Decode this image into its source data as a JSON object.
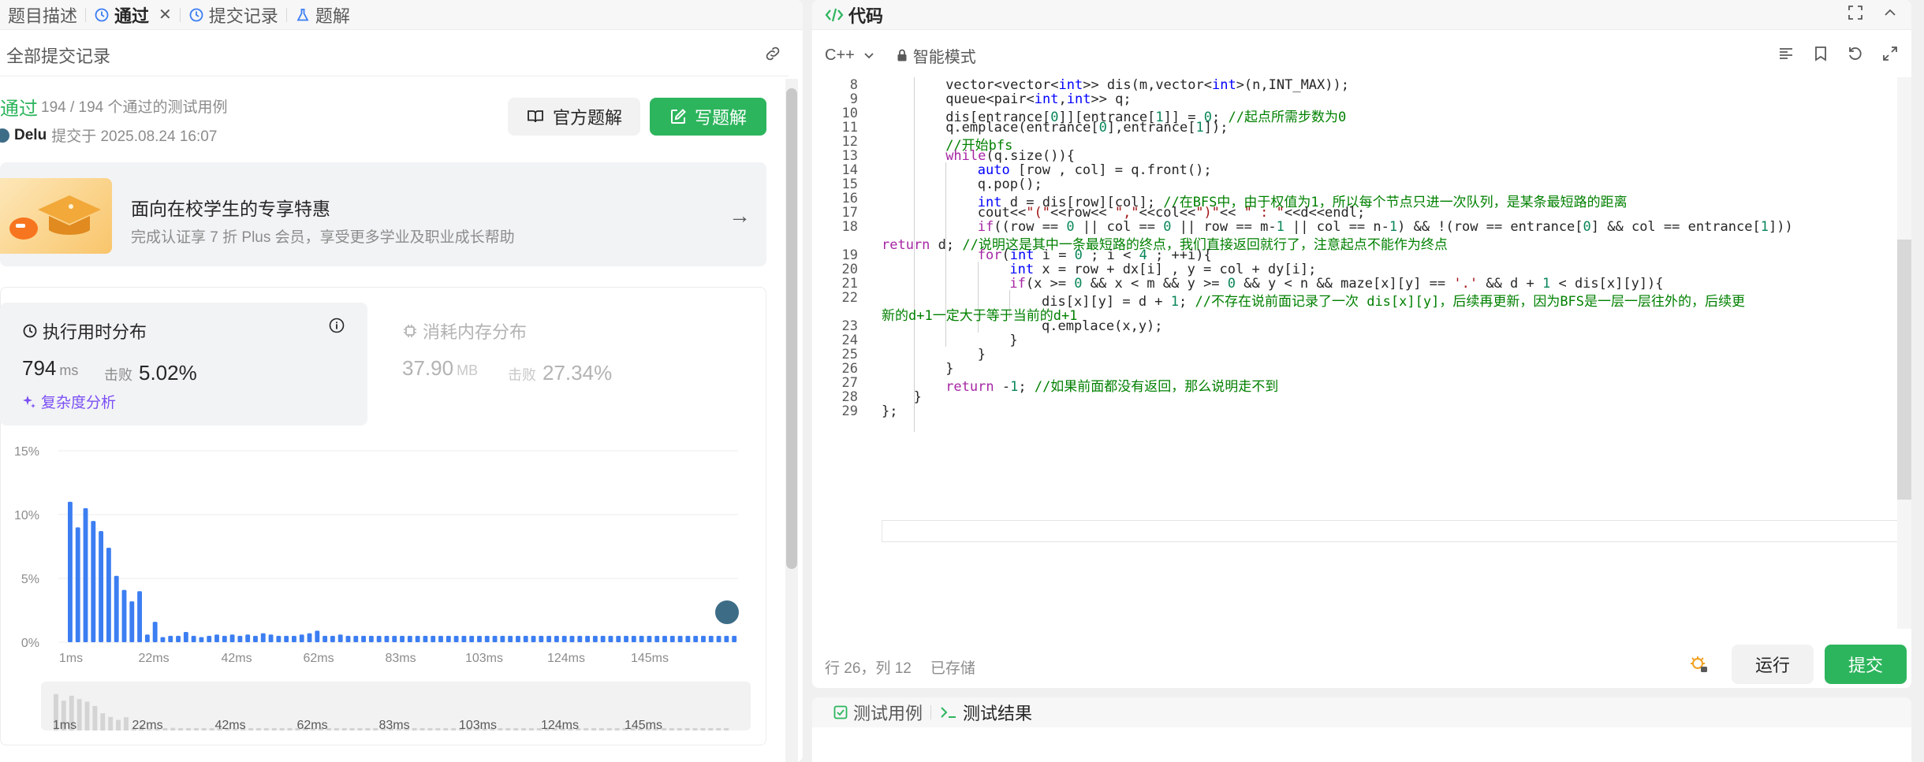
{
  "left_tabs": [
    {
      "label": "题目描述",
      "active": false
    },
    {
      "label": "通过",
      "active": true
    },
    {
      "label": "提交记录",
      "active": false
    },
    {
      "label": "题解",
      "active": false
    }
  ],
  "all_submissions_label": "全部提交记录",
  "result": {
    "status": "通过",
    "tests": "194 / 194 个通过的测试用例",
    "user": "Delu",
    "submitted_at": "提交于 2025.08.24 16:07"
  },
  "buttons": {
    "official": "官方题解",
    "write": "写题解",
    "run": "运行",
    "submit": "提交"
  },
  "promo": {
    "title": "面向在校学生的专享特惠",
    "subtitle": "完成认证享 7 折 Plus 会员，享受更多学业及职业成长帮助"
  },
  "runtime": {
    "title": "执行用时分布",
    "value": "794",
    "unit": "ms",
    "beat_label": "击败",
    "beat": "5.02%",
    "complexity": "复杂度分析"
  },
  "memory": {
    "title": "消耗内存分布",
    "value": "37.90",
    "unit": "MB",
    "beat_label": "击败",
    "beat": "27.34%"
  },
  "chart_data": {
    "type": "bar",
    "y_ticks": [
      "15%",
      "10%",
      "5%",
      "0%"
    ],
    "ylim": [
      0,
      15
    ],
    "x_ticks": [
      "1ms",
      "22ms",
      "42ms",
      "62ms",
      "83ms",
      "103ms",
      "124ms",
      "145ms"
    ],
    "overview_ticks": [
      "1ms",
      "22ms",
      "42ms",
      "62ms",
      "83ms",
      "103ms",
      "124ms",
      "145ms"
    ],
    "values": [
      11,
      9,
      10.5,
      9.5,
      8.7,
      7.4,
      5.2,
      4.1,
      3.2,
      4.0,
      0.6,
      1.6,
      0.4,
      0.5,
      0.5,
      0.8,
      0.5,
      0.4,
      0.5,
      0.6,
      0.5,
      0.6,
      0.5,
      0.6,
      0.5,
      0.7,
      0.6,
      0.5,
      0.5,
      0.5,
      0.6,
      0.7,
      0.9,
      0.5,
      0.5,
      0.6,
      0.5,
      0.5,
      0.5,
      0.5,
      0.5,
      0.5,
      0.5,
      0.5,
      0.5,
      0.5,
      0.5,
      0.5,
      0.5,
      0.5,
      0.5,
      0.5,
      0.5,
      0.5,
      0.5,
      0.5,
      0.5,
      0.5,
      0.5,
      0.5,
      0.5,
      0.5,
      0.5,
      0.5,
      0.5,
      0.5,
      0.5,
      0.5,
      0.5,
      0.5,
      0.5,
      0.5,
      0.5,
      0.5,
      0.5,
      0.5,
      0.5,
      0.5,
      0.5,
      0.5,
      0.5,
      0.5,
      0.5,
      0.5,
      0.5,
      0.5,
      0.5
    ]
  },
  "code_panel": {
    "title": "代码",
    "language": "C++",
    "mode": "智能模式"
  },
  "code_lines": [
    {
      "n": "8",
      "indent": 2,
      "html": "vector&lt;vector&lt;<span class='ty'>int</span>&gt;&gt; dis(m,vector&lt;<span class='ty'>int</span>&gt;(n,INT_MAX));"
    },
    {
      "n": "9",
      "indent": 2,
      "html": "queue&lt;pair&lt;<span class='ty'>int</span>,<span class='ty'>int</span>&gt;&gt; q;"
    },
    {
      "n": "10",
      "indent": 2,
      "html": "dis[entrance[<span class='num'>0</span>]][entrance[<span class='num'>1</span>]] = <span class='num'>0</span>; <span class='cm'>//起点所需步数为0</span>"
    },
    {
      "n": "11",
      "indent": 2,
      "html": "q.emplace(entrance[<span class='num'>0</span>],entrance[<span class='num'>1</span>]);"
    },
    {
      "n": "12",
      "indent": 2,
      "html": "<span class='cm'>//开始bfs</span>"
    },
    {
      "n": "13",
      "indent": 2,
      "html": "<span class='kw'>while</span>(q.size()){"
    },
    {
      "n": "14",
      "indent": 3,
      "html": "<span class='ty'>auto</span> [row , col] = q.front();"
    },
    {
      "n": "15",
      "indent": 3,
      "html": "q.pop();"
    },
    {
      "n": "16",
      "indent": 3,
      "html": "<span class='ty'>int</span> d = dis[row][col]; <span class='cm'>//在BFS中，由于权值为1，所以每个节点只进一次队列，是某条最短路的距离</span>"
    },
    {
      "n": "17",
      "indent": 3,
      "html": "cout&lt;&lt;<span class='str'>\"(\"</span>&lt;&lt;row&lt;&lt; <span class='str'>\",\"</span>&lt;&lt;col&lt;&lt;<span class='str'>\")\"</span>&lt;&lt; <span class='str'>\" : \"</span>&lt;&lt;d&lt;&lt;endl;"
    },
    {
      "n": "18",
      "indent": 3,
      "html": "<span class='kw'>if</span>((row == <span class='num'>0</span> || col == <span class='num'>0</span> || row == m-<span class='num'>1</span> || col == n-<span class='num'>1</span>) &amp;&amp; !(row == entrance[<span class='num'>0</span>] &amp;&amp; col == entrance[<span class='num'>1</span>]))"
    },
    {
      "n": "",
      "indent": 0,
      "html": "<span class='kw'>return</span> d; <span class='cm'>//说明这是其中一条最短路的终点，我们直接返回就行了，注意起点不能作为终点</span>"
    },
    {
      "n": "19",
      "indent": 3,
      "html": "<span class='kw'>for</span>(<span class='ty'>int</span> i = <span class='num'>0</span> ; i &lt; <span class='num'>4</span> ; ++i){"
    },
    {
      "n": "20",
      "indent": 4,
      "html": "<span class='ty'>int</span> x = row + dx[i] , y = col + dy[i];"
    },
    {
      "n": "21",
      "indent": 4,
      "html": "<span class='kw'>if</span>(x &gt;= <span class='num'>0</span> &amp;&amp; x &lt; m &amp;&amp; y &gt;= <span class='num'>0</span> &amp;&amp; y &lt; n &amp;&amp; maze[x][y] == <span class='str'>'.'</span> &amp;&amp; d + <span class='num'>1</span> &lt; dis[x][y]){"
    },
    {
      "n": "22",
      "indent": 5,
      "html": "dis[x][y] = d + <span class='num'>1</span>; <span class='cm'>//不存在说前面记录了一次 dis[x][y]，后续再更新，因为BFS是一层一层往外的，后续更</span>"
    },
    {
      "n": "",
      "indent": 0,
      "html": "<span class='cm'>新的d+1一定大于等于当前的d+1</span>"
    },
    {
      "n": "23",
      "indent": 5,
      "html": "q.emplace(x,y);"
    },
    {
      "n": "24",
      "indent": 4,
      "html": "}"
    },
    {
      "n": "25",
      "indent": 3,
      "html": "}"
    },
    {
      "n": "26",
      "indent": 2,
      "html": "}"
    },
    {
      "n": "27",
      "indent": 2,
      "html": "<span class='kw'>return</span> -<span class='num'>1</span>; <span class='cm'>//如果前面都没有返回，那么说明走不到</span>"
    },
    {
      "n": "28",
      "indent": 1,
      "html": "}"
    },
    {
      "n": "29",
      "indent": 0,
      "html": "};"
    }
  ],
  "editor_status": {
    "position": "行 26，列 12",
    "saved": "已存储"
  },
  "bottom_tabs": [
    {
      "label": "测试用例"
    },
    {
      "label": "测试结果"
    }
  ],
  "colors": {
    "accent_green": "#2db55d",
    "bar_blue": "#3c7ef2",
    "complexity_purple": "#7b4ff5"
  }
}
